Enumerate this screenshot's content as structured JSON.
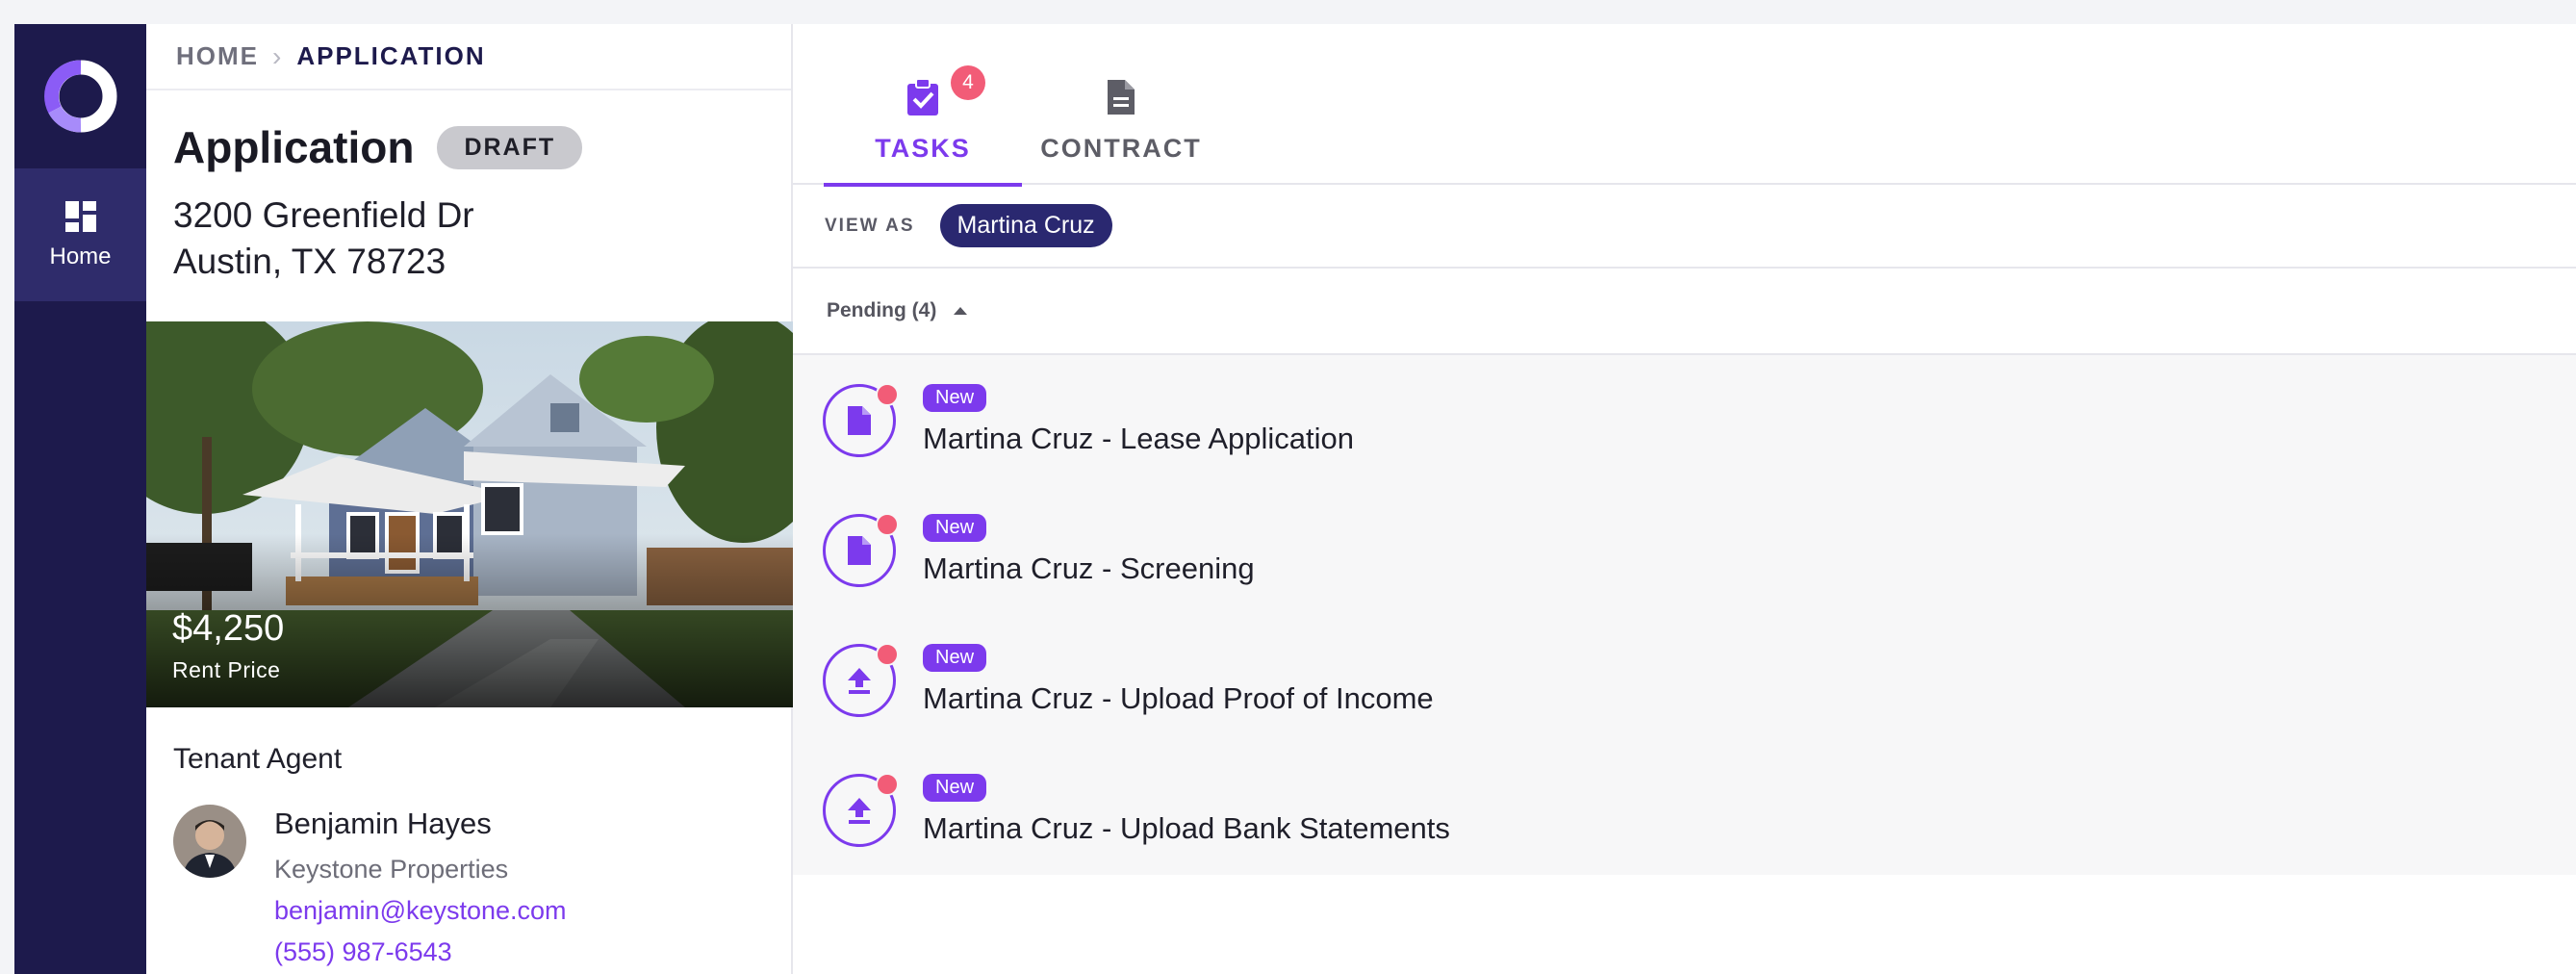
{
  "colors": {
    "accent": "#7c3aed",
    "navy": "#1d1a4c",
    "alert": "#f25c77"
  },
  "rail": {
    "home_label": "Home"
  },
  "breadcrumb": {
    "home": "HOME",
    "current": "APPLICATION"
  },
  "property": {
    "title": "Application",
    "status": "DRAFT",
    "address_line1": "3200 Greenfield Dr",
    "address_line2": "Austin, TX 78723",
    "price": "$4,250",
    "price_label": "Rent Price"
  },
  "agent": {
    "heading": "Tenant Agent",
    "name": "Benjamin Hayes",
    "company": "Keystone Properties",
    "email": "benjamin@keystone.com",
    "phone": "(555) 987-6543"
  },
  "tabs": [
    {
      "label": "TASKS",
      "icon": "clipboard-check-icon",
      "badge": "4",
      "active": true
    },
    {
      "label": "CONTRACT",
      "icon": "document-icon",
      "active": false
    }
  ],
  "view_as": {
    "label": "VIEW AS",
    "value": "Martina Cruz"
  },
  "pending": {
    "label": "Pending (4)"
  },
  "tasks": [
    {
      "badge": "New",
      "title": "Martina Cruz - Lease Application",
      "icon": "document-icon"
    },
    {
      "badge": "New",
      "title": "Martina Cruz - Screening",
      "icon": "document-icon"
    },
    {
      "badge": "New",
      "title": "Martina Cruz - Upload Proof of Income",
      "icon": "upload-icon"
    },
    {
      "badge": "New",
      "title": "Martina Cruz - Upload Bank Statements",
      "icon": "upload-icon"
    }
  ]
}
